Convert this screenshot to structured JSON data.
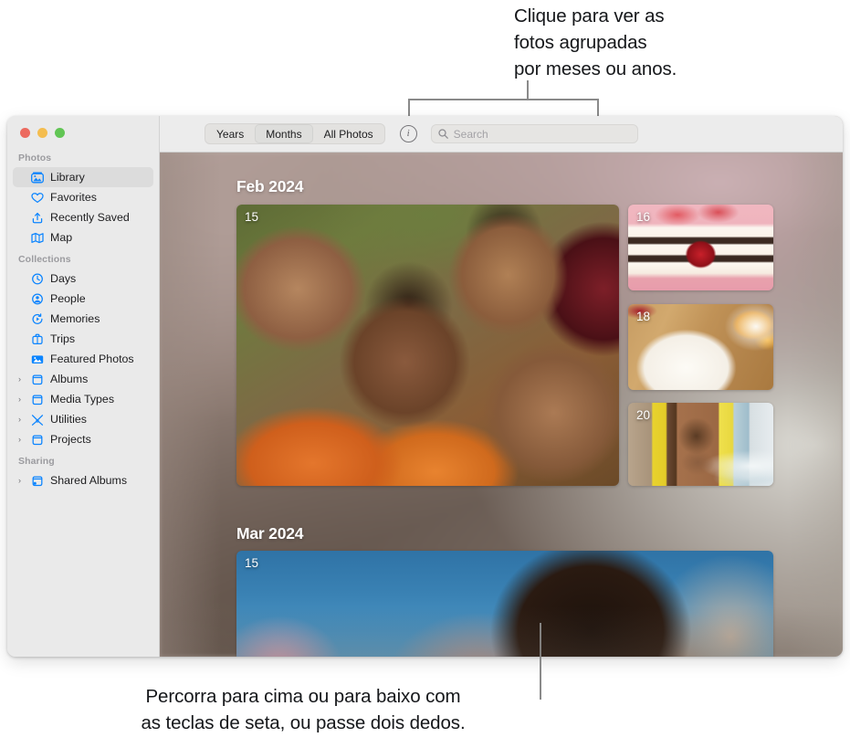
{
  "callouts": {
    "top": "Clique para ver as\nfotos agrupadas\npor meses ou anos.",
    "bottom": "Percorra para cima ou para baixo com\nas teclas de seta, ou passe dois dedos."
  },
  "window": {
    "traffic_lights": [
      {
        "name": "close",
        "color": "#ec6a5f"
      },
      {
        "name": "minimize",
        "color": "#f4bd4f"
      },
      {
        "name": "zoom",
        "color": "#61c554"
      }
    ]
  },
  "sidebar": {
    "sections": [
      {
        "title": "Photos",
        "items": [
          {
            "label": "Library",
            "icon": "library-icon",
            "selected": true,
            "twisty": ""
          },
          {
            "label": "Favorites",
            "icon": "heart-icon",
            "selected": false,
            "twisty": ""
          },
          {
            "label": "Recently Saved",
            "icon": "recently-saved-icon",
            "selected": false,
            "twisty": ""
          },
          {
            "label": "Map",
            "icon": "map-icon",
            "selected": false,
            "twisty": ""
          }
        ]
      },
      {
        "title": "Collections",
        "items": [
          {
            "label": "Days",
            "icon": "clock-icon",
            "selected": false,
            "twisty": ""
          },
          {
            "label": "People",
            "icon": "person-icon",
            "selected": false,
            "twisty": ""
          },
          {
            "label": "Memories",
            "icon": "memories-icon",
            "selected": false,
            "twisty": ""
          },
          {
            "label": "Trips",
            "icon": "suitcase-icon",
            "selected": false,
            "twisty": ""
          },
          {
            "label": "Featured Photos",
            "icon": "featured-photos-icon",
            "selected": false,
            "twisty": ""
          },
          {
            "label": "Albums",
            "icon": "album-icon",
            "selected": false,
            "twisty": "›"
          },
          {
            "label": "Media Types",
            "icon": "album-icon",
            "selected": false,
            "twisty": "›"
          },
          {
            "label": "Utilities",
            "icon": "utilities-icon",
            "selected": false,
            "twisty": "›"
          },
          {
            "label": "Projects",
            "icon": "album-icon",
            "selected": false,
            "twisty": "›"
          }
        ]
      },
      {
        "title": "Sharing",
        "items": [
          {
            "label": "Shared Albums",
            "icon": "shared-album-icon",
            "selected": false,
            "twisty": "›"
          }
        ]
      }
    ]
  },
  "toolbar": {
    "segments": [
      {
        "label": "Years",
        "active": false
      },
      {
        "label": "Months",
        "active": true
      },
      {
        "label": "All Photos",
        "active": false
      }
    ],
    "info_label": "i",
    "search": {
      "placeholder": "Search",
      "value": ""
    }
  },
  "grid": {
    "months": [
      {
        "heading": "Feb 2024",
        "photos": [
          {
            "id": "photo-feb-15",
            "day": "15",
            "subject": "group-selfie-park"
          },
          {
            "id": "photo-feb-16",
            "day": "16",
            "subject": "strawberry-layer-cake"
          },
          {
            "id": "photo-feb-18",
            "day": "18",
            "subject": "roasted-carrots-and-oranges"
          },
          {
            "id": "photo-feb-20",
            "day": "20",
            "subject": "person-with-yellow-scarf-at-beach"
          }
        ]
      },
      {
        "heading": "Mar 2024",
        "photos": [
          {
            "id": "photo-mar-15",
            "day": "15",
            "subject": "two-people-lying-under-blue-sky"
          }
        ]
      }
    ]
  }
}
